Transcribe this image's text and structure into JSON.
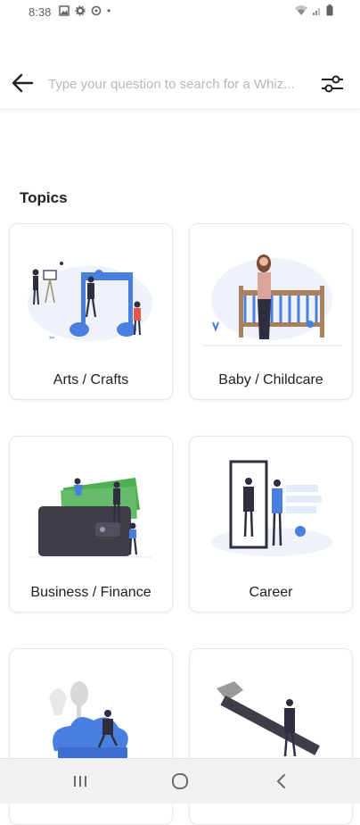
{
  "status_bar": {
    "time": "8:38",
    "dot": "•"
  },
  "search": {
    "placeholder": "Type your question to search for a Whiz..."
  },
  "section": {
    "title": "Topics"
  },
  "topics": [
    {
      "label": "Arts / Crafts",
      "icon": "arts-crafts-illustration"
    },
    {
      "label": "Baby / Childcare",
      "icon": "baby-childcare-illustration"
    },
    {
      "label": "Business / Finance",
      "icon": "business-finance-illustration"
    },
    {
      "label": "Career",
      "icon": "career-illustration"
    },
    {
      "label": "",
      "icon": "cooking-illustration"
    },
    {
      "label": "",
      "icon": "home-improvement-illustration"
    }
  ],
  "colors": {
    "accent_blue": "#4a7fe0",
    "dark_figure": "#2f2e41",
    "wallet": "#3f3d4a",
    "money_green": "#4caf50"
  }
}
